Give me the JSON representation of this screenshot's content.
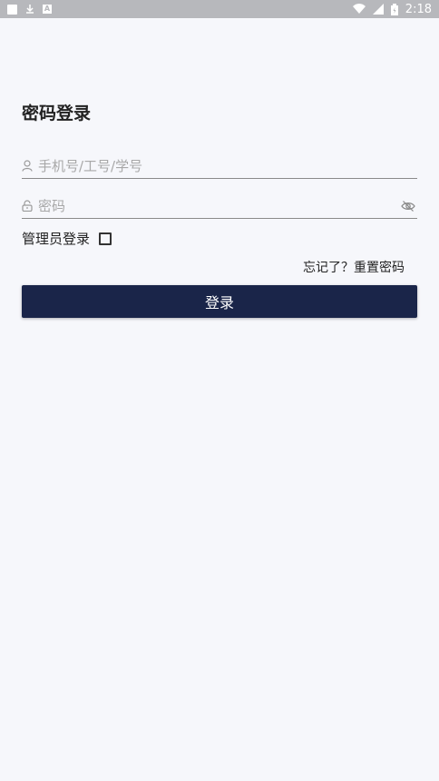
{
  "status_bar": {
    "time": "2:18",
    "notif_icons": [
      "square-notification-icon",
      "download-icon",
      "a-icon"
    ],
    "a_icon_text": "A",
    "system_icons": [
      "wifi-icon",
      "signal-icon",
      "battery-icon"
    ]
  },
  "page": {
    "title": "密码登录"
  },
  "form": {
    "phone_placeholder": "手机号/工号/学号",
    "phone_value": "",
    "password_placeholder": "密码",
    "password_value": "",
    "admin_label": "管理员登录",
    "admin_checked": false,
    "forgot_label": "忘记了？重置密码",
    "login_label": "登录"
  },
  "colors": {
    "background": "#f6f7fb",
    "status_bar": "#b7b8bc",
    "button": "#1a2549",
    "button_text": "#ffffff"
  }
}
